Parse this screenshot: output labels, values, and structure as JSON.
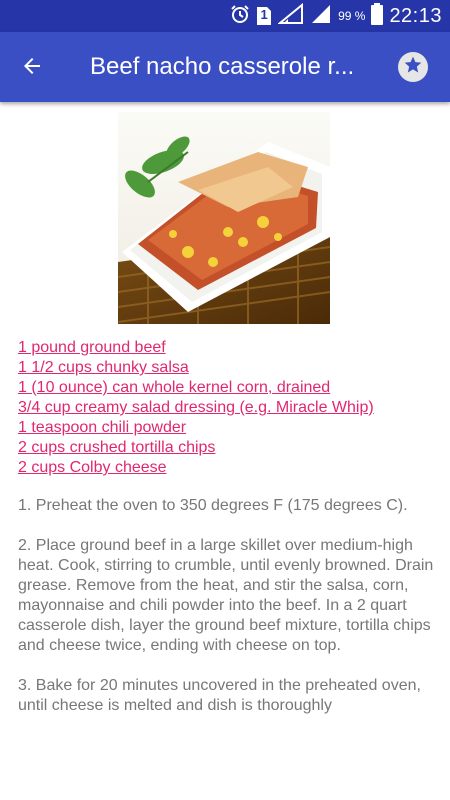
{
  "status_bar": {
    "battery_percent": "99 %",
    "sim_label": "1",
    "time": "22:13"
  },
  "toolbar": {
    "title": "Beef nacho casserole r..."
  },
  "ingredients": [
    "1 pound ground beef",
    "1 1/2 cups chunky salsa",
    "1 (10 ounce) can whole kernel corn, drained",
    "3/4 cup creamy salad dressing (e.g. Miracle Whip)",
    "1 teaspoon chili powder",
    "2 cups crushed tortilla chips",
    "2 cups Colby cheese"
  ],
  "steps": [
    "1. Preheat the oven to 350 degrees F (175 degrees C).",
    "2. Place ground beef in a large skillet over medium-high heat. Cook, stirring to crumble, until evenly browned. Drain grease. Remove from the heat, and stir the salsa, corn, mayonnaise and chili powder into the beef. In a 2 quart casserole dish, layer the ground beef mixture, tortilla chips and cheese twice, ending with cheese on top.",
    "3. Bake for 20 minutes uncovered in the preheated oven, until cheese is melted and dish is thoroughly"
  ],
  "icons": {
    "back": "arrow-back-icon",
    "favorite": "star-icon",
    "alarm": "alarm-icon",
    "sim": "sim-icon",
    "signal": "signal-icon",
    "battery": "battery-icon"
  },
  "colors": {
    "status_bar": "#2636a8",
    "toolbar": "#3b4fc4",
    "ingredient_link": "#e0286f",
    "step_text": "#777777"
  }
}
